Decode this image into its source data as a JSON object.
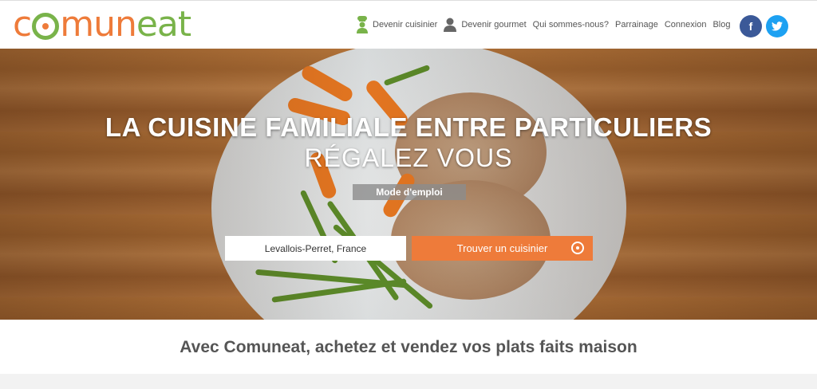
{
  "logo": {
    "part1": "c",
    "part2": "mun",
    "part3": "eat"
  },
  "nav": {
    "items": [
      {
        "label": "Devenir cuisinier",
        "icon": "chef-icon"
      },
      {
        "label": "Devenir gourmet",
        "icon": "user-icon"
      },
      {
        "label": "Qui sommes-nous?"
      },
      {
        "label": "Parrainage"
      },
      {
        "label": "Connexion"
      },
      {
        "label": "Blog"
      }
    ]
  },
  "social": {
    "facebook": "f",
    "twitter": "t"
  },
  "hero": {
    "title": "LA CUISINE FAMILIALE ENTRE PARTICULIERS",
    "subtitle": "RÉGALEZ VOUS",
    "mode_button": "Mode d'emploi",
    "location_value": "Levallois-Perret, France",
    "search_button": "Trouver un cuisinier"
  },
  "tagline": "Avec Comuneat, achetez et vendez vos plats faits maison",
  "colors": {
    "orange": "#ee7b3a",
    "green": "#79b34a",
    "facebook": "#3b5998",
    "twitter": "#1da1f2"
  }
}
